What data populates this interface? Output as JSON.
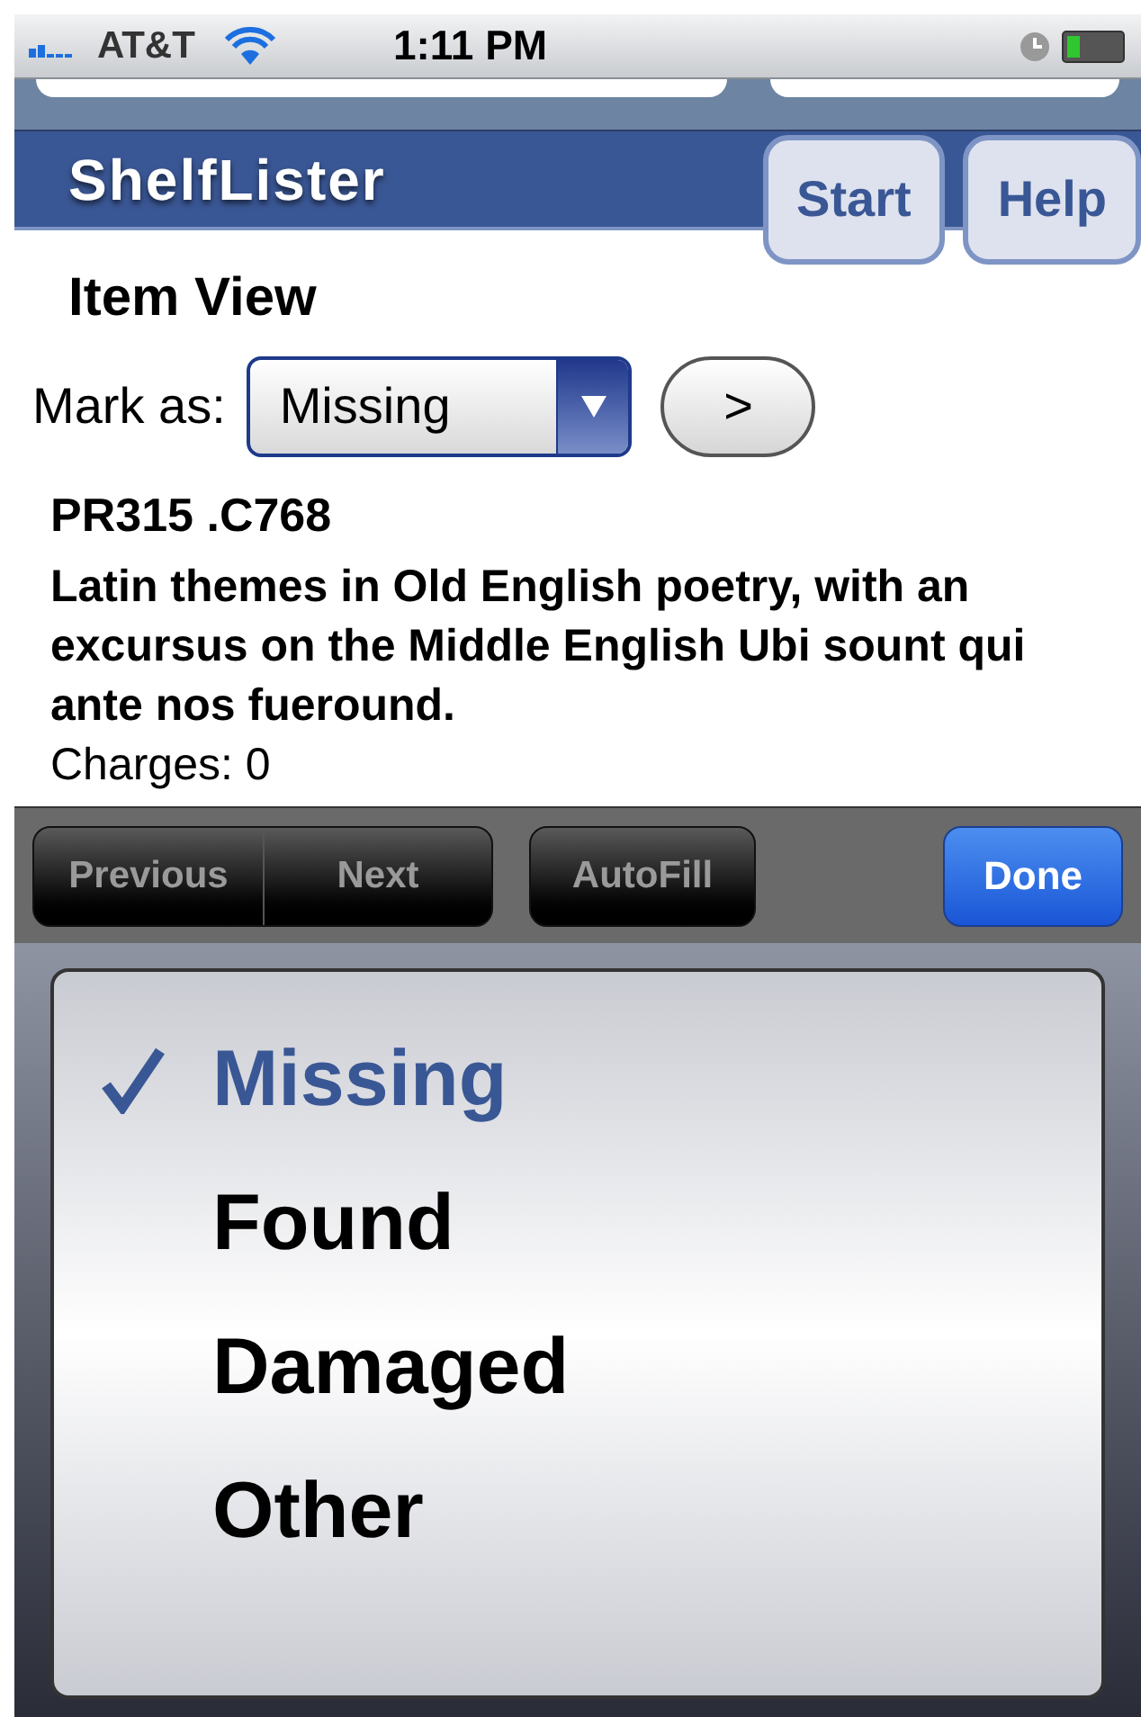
{
  "status_bar": {
    "carrier": "AT&T",
    "time": "1:11 PM"
  },
  "header": {
    "title": "ShelfLister",
    "buttons": [
      "Start",
      "Help"
    ]
  },
  "page_title": "Item View",
  "mark_as": {
    "label": "Mark as:",
    "value": "Missing",
    "go_button": ">"
  },
  "item": {
    "call_number": "PR315 .C768",
    "title": "Latin themes in Old English poetry, with an excursus on the Middle English Ubi sount qui ante nos fueround.",
    "charges": "Charges: 0"
  },
  "toolbar": {
    "nav_buttons": [
      "Previous",
      "Next"
    ],
    "autofill": "AutoFill",
    "done": "Done"
  },
  "picker": {
    "options": [
      {
        "label": "Missing",
        "selected": true
      },
      {
        "label": "Found",
        "selected": false
      },
      {
        "label": "Damaged",
        "selected": false
      },
      {
        "label": "Other",
        "selected": false
      }
    ]
  }
}
